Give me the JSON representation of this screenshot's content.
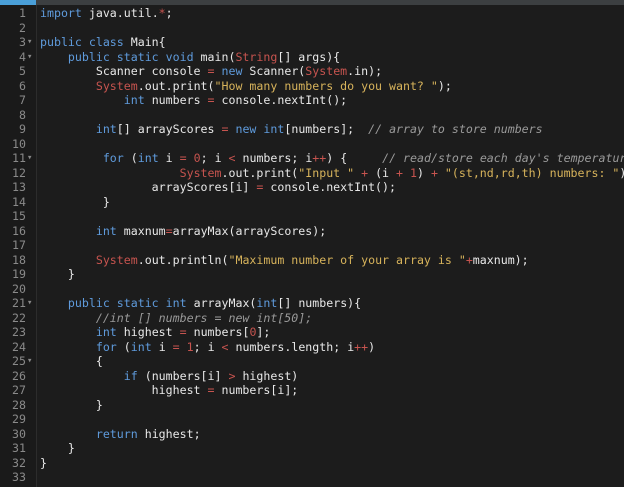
{
  "lines": [
    {
      "n": "1",
      "fold": "",
      "tokens": [
        [
          "kw",
          "import"
        ],
        [
          "pl",
          " java.util."
        ],
        [
          "op",
          "*"
        ],
        [
          "pl",
          ";"
        ]
      ]
    },
    {
      "n": "2",
      "fold": "",
      "tokens": []
    },
    {
      "n": "3",
      "fold": "▾",
      "tokens": [
        [
          "kw",
          "public class"
        ],
        [
          "pl",
          " Main{"
        ]
      ]
    },
    {
      "n": "4",
      "fold": "▾",
      "tokens": [
        [
          "pl",
          "    "
        ],
        [
          "kw",
          "public static void"
        ],
        [
          "pl",
          " main("
        ],
        [
          "sys",
          "String"
        ],
        [
          "pl",
          "[] args){"
        ]
      ]
    },
    {
      "n": "5",
      "fold": "",
      "tokens": [
        [
          "pl",
          "        Scanner console "
        ],
        [
          "op",
          "="
        ],
        [
          "pl",
          " "
        ],
        [
          "kw",
          "new"
        ],
        [
          "pl",
          " Scanner("
        ],
        [
          "sys",
          "System"
        ],
        [
          "pl",
          ".in);"
        ]
      ]
    },
    {
      "n": "6",
      "fold": "",
      "tokens": [
        [
          "pl",
          "        "
        ],
        [
          "sys",
          "System"
        ],
        [
          "pl",
          ".out.print("
        ],
        [
          "str",
          "\"How many numbers do you want? \""
        ],
        [
          "pl",
          ");"
        ]
      ]
    },
    {
      "n": "7",
      "fold": "",
      "tokens": [
        [
          "pl",
          "            "
        ],
        [
          "ty",
          "int"
        ],
        [
          "pl",
          " numbers "
        ],
        [
          "op",
          "="
        ],
        [
          "pl",
          " console.nextInt();"
        ]
      ]
    },
    {
      "n": "8",
      "fold": "",
      "tokens": []
    },
    {
      "n": "9",
      "fold": "",
      "tokens": [
        [
          "pl",
          "        "
        ],
        [
          "ty",
          "int"
        ],
        [
          "pl",
          "[] arrayScores "
        ],
        [
          "op",
          "="
        ],
        [
          "pl",
          " "
        ],
        [
          "kw",
          "new"
        ],
        [
          "pl",
          " "
        ],
        [
          "ty",
          "int"
        ],
        [
          "pl",
          "[numbers];  "
        ],
        [
          "cm",
          "// array to store numbers"
        ]
      ]
    },
    {
      "n": "10",
      "fold": "",
      "tokens": []
    },
    {
      "n": "11",
      "fold": "▾",
      "tokens": [
        [
          "pl",
          "         "
        ],
        [
          "kw",
          "for"
        ],
        [
          "pl",
          " ("
        ],
        [
          "ty",
          "int"
        ],
        [
          "pl",
          " i "
        ],
        [
          "op",
          "="
        ],
        [
          "pl",
          " "
        ],
        [
          "num",
          "0"
        ],
        [
          "pl",
          "; i "
        ],
        [
          "op",
          "<"
        ],
        [
          "pl",
          " numbers; i"
        ],
        [
          "op",
          "++"
        ],
        [
          "pl",
          ") {     "
        ],
        [
          "cm",
          "// read/store each day's temperature"
        ]
      ]
    },
    {
      "n": "12",
      "fold": "",
      "tokens": [
        [
          "pl",
          "                    "
        ],
        [
          "sys",
          "System"
        ],
        [
          "pl",
          ".out.print("
        ],
        [
          "str",
          "\"Input \""
        ],
        [
          "pl",
          " "
        ],
        [
          "op",
          "+"
        ],
        [
          "pl",
          " (i "
        ],
        [
          "op",
          "+"
        ],
        [
          "pl",
          " "
        ],
        [
          "num",
          "1"
        ],
        [
          "pl",
          ") "
        ],
        [
          "op",
          "+"
        ],
        [
          "pl",
          " "
        ],
        [
          "str",
          "\"(st,nd,rd,th) numbers: \""
        ],
        [
          "pl",
          ");"
        ]
      ]
    },
    {
      "n": "13",
      "fold": "",
      "tokens": [
        [
          "pl",
          "                arrayScores[i] "
        ],
        [
          "op",
          "="
        ],
        [
          "pl",
          " console.nextInt();"
        ]
      ]
    },
    {
      "n": "14",
      "fold": "",
      "tokens": [
        [
          "pl",
          "         }"
        ]
      ]
    },
    {
      "n": "15",
      "fold": "",
      "tokens": []
    },
    {
      "n": "16",
      "fold": "",
      "tokens": [
        [
          "pl",
          "        "
        ],
        [
          "ty",
          "int"
        ],
        [
          "pl",
          " maxnum"
        ],
        [
          "op",
          "="
        ],
        [
          "pl",
          "arrayMax(arrayScores);"
        ]
      ]
    },
    {
      "n": "17",
      "fold": "",
      "tokens": []
    },
    {
      "n": "18",
      "fold": "",
      "tokens": [
        [
          "pl",
          "        "
        ],
        [
          "sys",
          "System"
        ],
        [
          "pl",
          ".out.println("
        ],
        [
          "str",
          "\"Maximum number of your array is \""
        ],
        [
          "op",
          "+"
        ],
        [
          "pl",
          "maxnum);"
        ]
      ]
    },
    {
      "n": "19",
      "fold": "",
      "tokens": [
        [
          "pl",
          "    }"
        ]
      ]
    },
    {
      "n": "20",
      "fold": "",
      "tokens": []
    },
    {
      "n": "21",
      "fold": "▾",
      "tokens": [
        [
          "pl",
          "    "
        ],
        [
          "kw",
          "public static"
        ],
        [
          "pl",
          " "
        ],
        [
          "ty",
          "int"
        ],
        [
          "pl",
          " arrayMax("
        ],
        [
          "ty",
          "int"
        ],
        [
          "pl",
          "[] numbers){"
        ]
      ]
    },
    {
      "n": "22",
      "fold": "",
      "tokens": [
        [
          "pl",
          "        "
        ],
        [
          "cm",
          "//int [] numbers = new int[50];"
        ]
      ]
    },
    {
      "n": "23",
      "fold": "",
      "tokens": [
        [
          "pl",
          "        "
        ],
        [
          "ty",
          "int"
        ],
        [
          "pl",
          " highest "
        ],
        [
          "op",
          "="
        ],
        [
          "pl",
          " numbers["
        ],
        [
          "num",
          "0"
        ],
        [
          "pl",
          "];"
        ]
      ]
    },
    {
      "n": "24",
      "fold": "",
      "tokens": [
        [
          "pl",
          "        "
        ],
        [
          "kw",
          "for"
        ],
        [
          "pl",
          " ("
        ],
        [
          "ty",
          "int"
        ],
        [
          "pl",
          " i "
        ],
        [
          "op",
          "="
        ],
        [
          "pl",
          " "
        ],
        [
          "num",
          "1"
        ],
        [
          "pl",
          "; i "
        ],
        [
          "op",
          "<"
        ],
        [
          "pl",
          " numbers.length; i"
        ],
        [
          "op",
          "++"
        ],
        [
          "pl",
          ")"
        ]
      ]
    },
    {
      "n": "25",
      "fold": "▾",
      "tokens": [
        [
          "pl",
          "        {"
        ]
      ]
    },
    {
      "n": "26",
      "fold": "",
      "tokens": [
        [
          "pl",
          "            "
        ],
        [
          "kw",
          "if"
        ],
        [
          "pl",
          " (numbers[i] "
        ],
        [
          "op",
          ">"
        ],
        [
          "pl",
          " highest)"
        ]
      ]
    },
    {
      "n": "27",
      "fold": "",
      "tokens": [
        [
          "pl",
          "                highest "
        ],
        [
          "op",
          "="
        ],
        [
          "pl",
          " numbers[i];"
        ]
      ]
    },
    {
      "n": "28",
      "fold": "",
      "tokens": [
        [
          "pl",
          "        }"
        ]
      ]
    },
    {
      "n": "29",
      "fold": "",
      "tokens": []
    },
    {
      "n": "30",
      "fold": "",
      "tokens": [
        [
          "pl",
          "        "
        ],
        [
          "kw",
          "return"
        ],
        [
          "pl",
          " highest;"
        ]
      ]
    },
    {
      "n": "31",
      "fold": "",
      "tokens": [
        [
          "pl",
          "    }"
        ]
      ]
    },
    {
      "n": "32",
      "fold": "",
      "tokens": [
        [
          "pl",
          "}"
        ]
      ]
    },
    {
      "n": "33",
      "fold": "",
      "tokens": []
    }
  ],
  "colors": {
    "background": "#1c1c1c",
    "keyword": "#5f9bdc",
    "string": "#d7b35b",
    "system_class": "#c7544f",
    "operator": "#c7544f",
    "comment": "#9a9a9a",
    "text": "#e8e8e8",
    "line_number": "#8a8a8a"
  }
}
